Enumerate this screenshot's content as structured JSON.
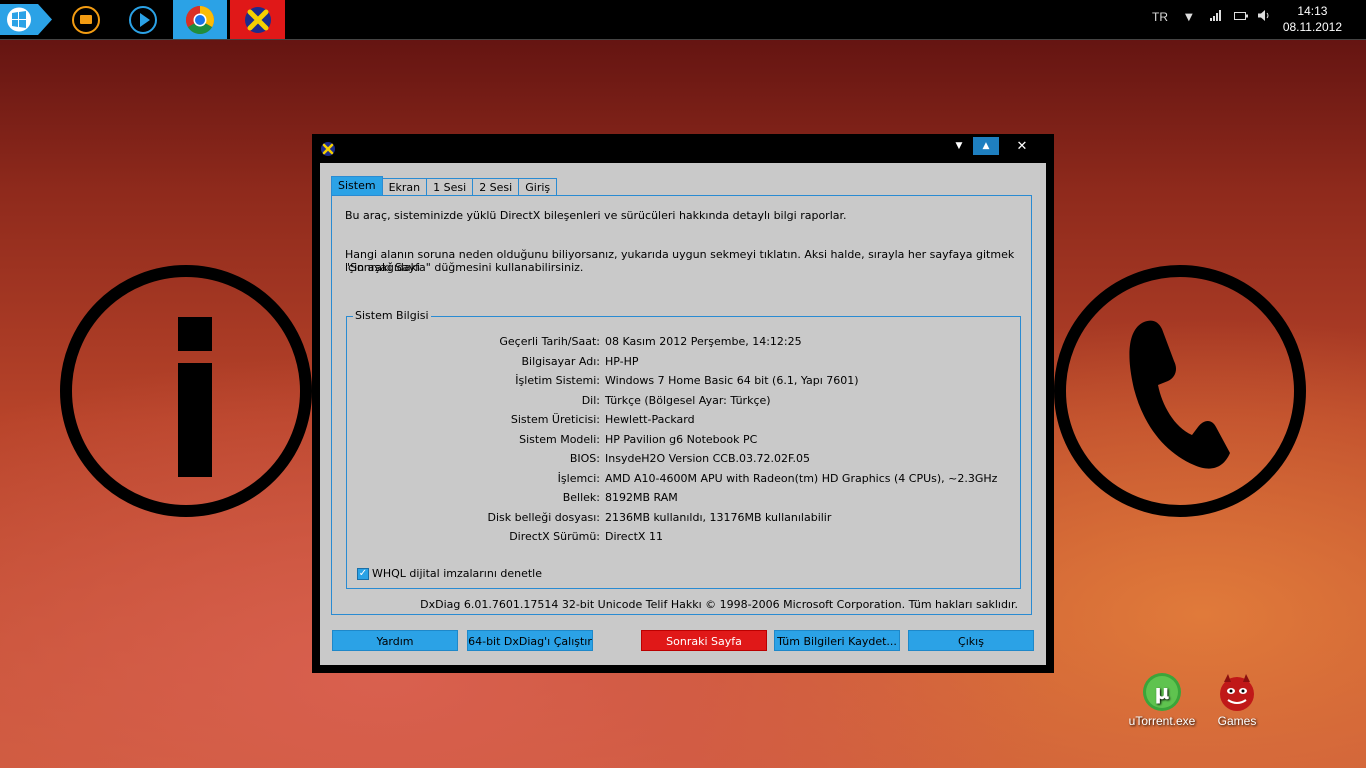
{
  "taskbar": {
    "lang": "TR",
    "clock_time": "14:13",
    "clock_date": "08.11.2012"
  },
  "desktop": {
    "icons": [
      {
        "label": "uTorrent.exe"
      },
      {
        "label": "Games"
      }
    ]
  },
  "window": {
    "tabs": [
      "Sistem",
      "Ekran",
      "1 Sesi",
      "2 Sesi",
      "Giriş"
    ],
    "intro1": "Bu araç, sisteminizde yüklü DirectX bileşenleri ve sürücüleri hakkında detaylı bilgi raporlar.",
    "intro2_line1": "Hangi alanın soruna neden olduğunu biliyorsanız, yukarıda uygun sekmeyi tıklatın.  Aksi halde, sırayla her sayfaya gitmek için aşağıdaki",
    "intro2_line2": "\"Sonraki Sayfa\" düğmesini kullanabilirsiniz.",
    "group_title": "Sistem Bilgisi",
    "rows": [
      {
        "label": "Geçerli Tarih/Saat:",
        "value": "08 Kasım 2012 Perşembe, 14:12:25"
      },
      {
        "label": "Bilgisayar Adı:",
        "value": "HP-HP"
      },
      {
        "label": "İşletim Sistemi:",
        "value": "Windows 7 Home Basic 64 bit (6.1, Yapı 7601)"
      },
      {
        "label": "Dil:",
        "value": "Türkçe (Bölgesel Ayar: Türkçe)"
      },
      {
        "label": "Sistem Üreticisi:",
        "value": "Hewlett-Packard"
      },
      {
        "label": "Sistem Modeli:",
        "value": "HP Pavilion g6 Notebook PC"
      },
      {
        "label": "BIOS:",
        "value": "InsydeH2O Version CCB.03.72.02F.05"
      },
      {
        "label": "İşlemci:",
        "value": "AMD A10-4600M APU with Radeon(tm) HD Graphics   (4 CPUs), ~2.3GHz"
      },
      {
        "label": "Bellek:",
        "value": "8192MB RAM"
      },
      {
        "label": "Disk belleği dosyası:",
        "value": "2136MB kullanıldı, 13176MB kullanılabilir"
      },
      {
        "label": "DirectX Sürümü:",
        "value": "DirectX 11"
      }
    ],
    "whql_checkbox": {
      "label": "WHQL dijital imzalarını denetle",
      "checked": true
    },
    "footer_note": "DxDiag 6.01.7601.17514 32-bit Unicode  Telif Hakkı © 1998-2006 Microsoft Corporation.  Tüm hakları saklıdır.",
    "buttons": {
      "help": "Yardım",
      "run64": "64-bit DxDiag'ı Çalıştır",
      "next": "Sonraki Sayfa",
      "save": "Tüm Bilgileri Kaydet...",
      "exit": "Çıkış"
    }
  },
  "colors": {
    "accent": "#2ba2e6",
    "next_button": "#e01818",
    "panel_bg": "#c9c9c9"
  }
}
